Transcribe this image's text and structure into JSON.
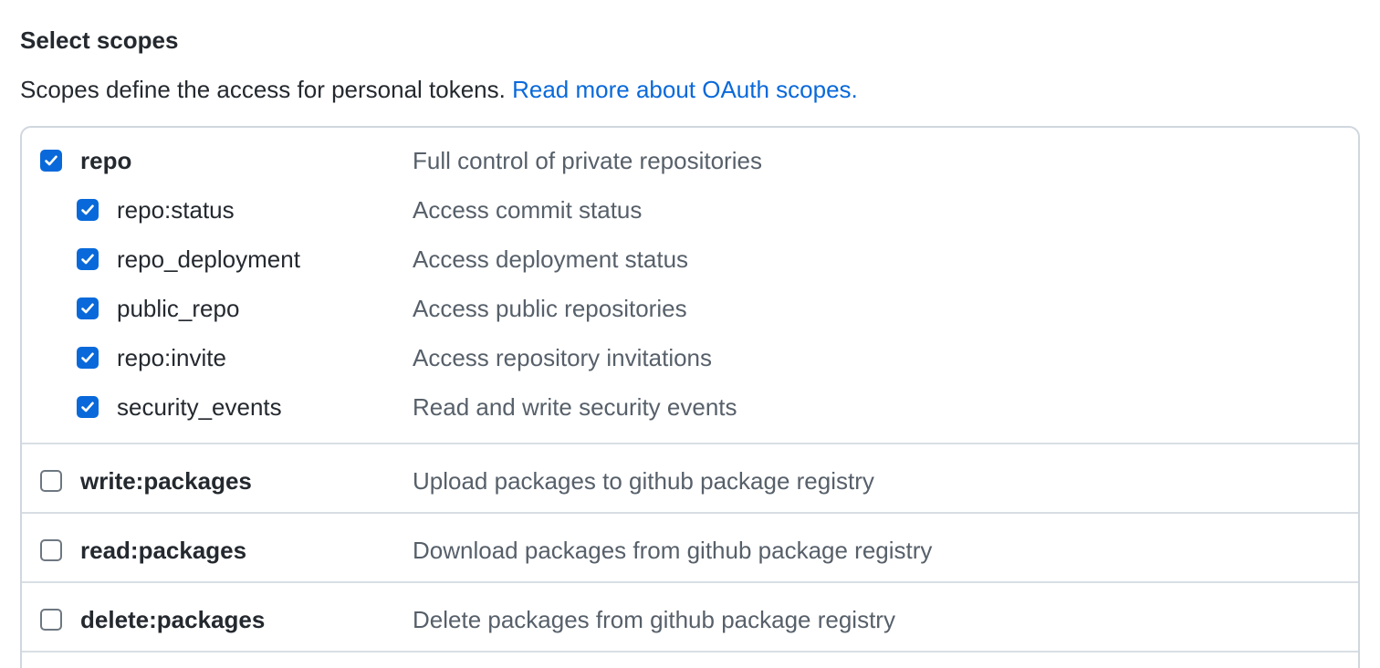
{
  "header": {
    "title": "Select scopes",
    "description": "Scopes define the access for personal tokens.",
    "link_text": "Read more about OAuth scopes."
  },
  "colors": {
    "accent": "#0969da",
    "text": "#24292f",
    "muted": "#57606a",
    "border": "#d0d7de"
  },
  "scopes": {
    "repo": {
      "name": "repo",
      "description": "Full control of private repositories",
      "checked": true,
      "children": [
        {
          "name": "repo:status",
          "description": "Access commit status",
          "checked": true
        },
        {
          "name": "repo_deployment",
          "description": "Access deployment status",
          "checked": true
        },
        {
          "name": "public_repo",
          "description": "Access public repositories",
          "checked": true
        },
        {
          "name": "repo:invite",
          "description": "Access repository invitations",
          "checked": true
        },
        {
          "name": "security_events",
          "description": "Read and write security events",
          "checked": true
        }
      ]
    },
    "write_packages": {
      "name": "write:packages",
      "description": "Upload packages to github package registry",
      "checked": false
    },
    "read_packages": {
      "name": "read:packages",
      "description": "Download packages from github package registry",
      "checked": false
    },
    "delete_packages": {
      "name": "delete:packages",
      "description": "Delete packages from github package registry",
      "checked": false
    }
  }
}
